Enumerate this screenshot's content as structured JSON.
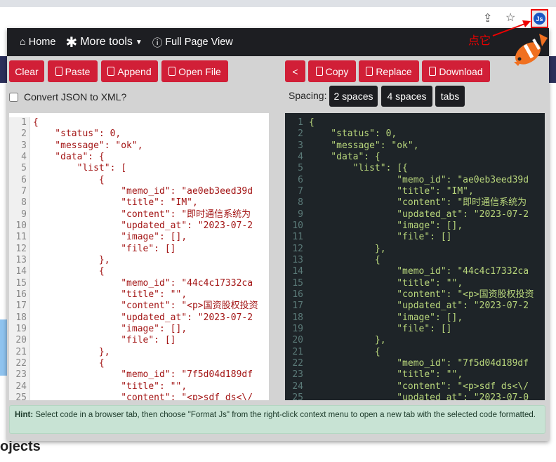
{
  "browser": {
    "extension_label": "Js",
    "annotation": "点它"
  },
  "page": {
    "heading_fragment": "ojects"
  },
  "header": {
    "home": "Home",
    "more_tools": "More tools",
    "full_page": "Full Page View"
  },
  "left_toolbar": {
    "clear": "Clear",
    "paste": "Paste",
    "append": "Append",
    "open_file": "Open File",
    "convert_label": "Convert JSON to XML?",
    "convert_checked": false
  },
  "right_toolbar": {
    "back": "<",
    "copy": "Copy",
    "replace": "Replace",
    "download": "Download",
    "spacing_label": "Spacing:",
    "spacing_options": [
      "2 spaces",
      "4 spaces",
      "tabs"
    ]
  },
  "colors": {
    "accent": "#d11f37",
    "header_bg": "#1d1e22",
    "editor_dark_bg": "#1e2428",
    "hint_bg": "#c8e3d4"
  },
  "left_editor": {
    "lines": [
      "{",
      "    \"status\": 0,",
      "    \"message\": \"ok\",",
      "    \"data\": {",
      "        \"list\": [",
      "            {",
      "                \"memo_id\": \"ae0eb3eed39d",
      "                \"title\": \"IM\",",
      "                \"content\": \"即时通信系统为",
      "                \"updated_at\": \"2023-07-2",
      "                \"image\": [],",
      "                \"file\": []",
      "            },",
      "            {",
      "                \"memo_id\": \"44c4c17332ca",
      "                \"title\": \"\",",
      "                \"content\": \"<p>国资股权投资",
      "                \"updated_at\": \"2023-07-2",
      "                \"image\": [],",
      "                \"file\": []",
      "            },",
      "            {",
      "                \"memo_id\": \"7f5d04d189df",
      "                \"title\": \"\",",
      "                \"content\": \"<p>sdf ds<\\/"
    ]
  },
  "right_editor": {
    "lines": [
      "{",
      "    \"status\": 0,",
      "    \"message\": \"ok\",",
      "    \"data\": {",
      "        \"list\": [{",
      "                \"memo_id\": \"ae0eb3eed39d",
      "                \"title\": \"IM\",",
      "                \"content\": \"即时通信系统为",
      "                \"updated_at\": \"2023-07-2",
      "                \"image\": [],",
      "                \"file\": []",
      "            },",
      "            {",
      "                \"memo_id\": \"44c4c17332ca",
      "                \"title\": \"\",",
      "                \"content\": \"<p>国资股权投资",
      "                \"updated_at\": \"2023-07-2",
      "                \"image\": [],",
      "                \"file\": []",
      "            },",
      "            {",
      "                \"memo_id\": \"7f5d04d189df",
      "                \"title\": \"\",",
      "                \"content\": \"<p>sdf ds<\\/",
      "                \"updated_at\": \"2023-07-0"
    ]
  },
  "hint": {
    "label": "Hint:",
    "text": " Select code in a browser tab, then choose \"Format Js\" from the right-click context menu to open a new tab with the selected code formatted."
  }
}
